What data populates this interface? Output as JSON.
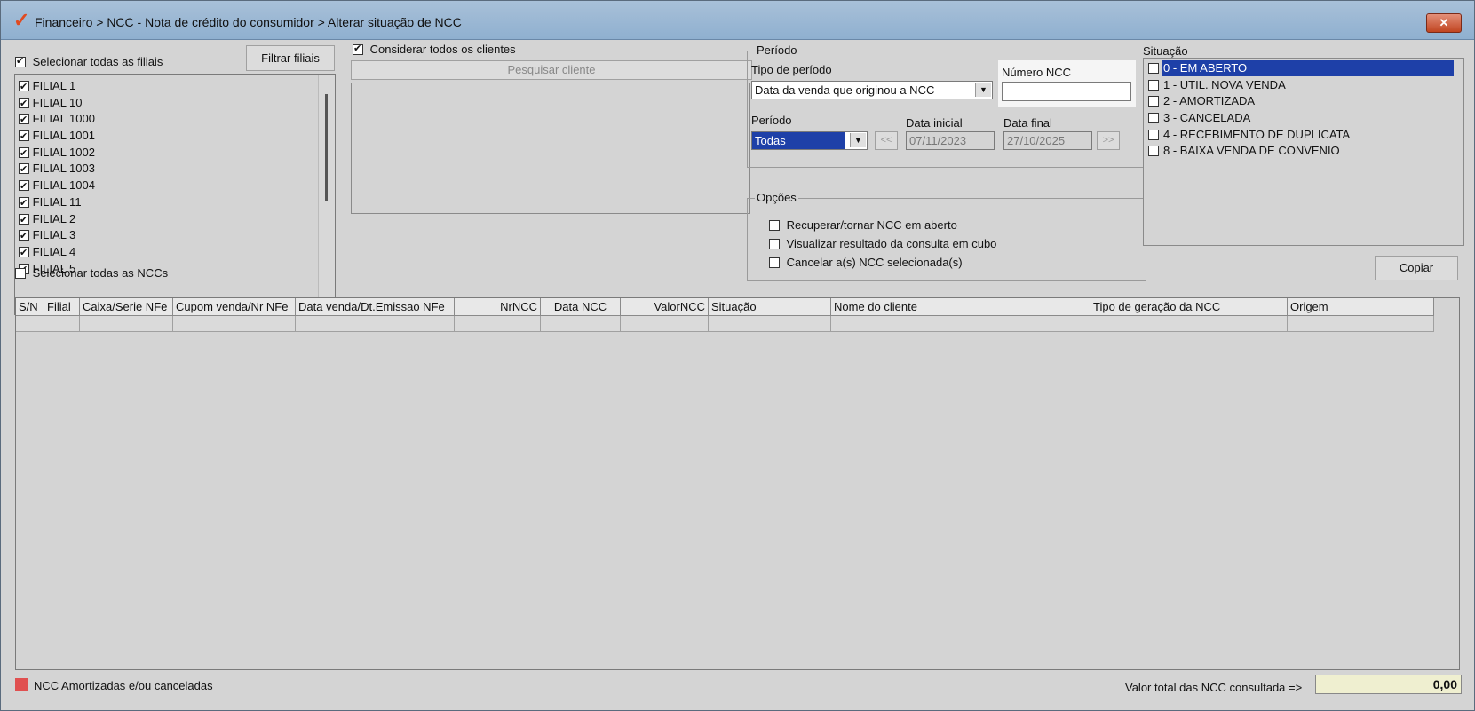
{
  "window": {
    "title": "Financeiro > NCC - Nota de crédito do consumidor > Alterar situação de NCC",
    "close": "✕"
  },
  "filiais": {
    "select_all_label": "Selecionar todas as filiais",
    "filter_button": "Filtrar filiais",
    "items": [
      "FILIAL 1",
      "FILIAL 10",
      "FILIAL 1000",
      "FILIAL 1001",
      "FILIAL 1002",
      "FILIAL 1003",
      "FILIAL 1004",
      "FILIAL 11",
      "FILIAL 2",
      "FILIAL 3",
      "FILIAL 4",
      "FILIAL 5"
    ]
  },
  "clientes": {
    "consider_all_label": "Considerar todos os clientes",
    "search_button": "Pesquisar cliente"
  },
  "periodo": {
    "legend": "Período",
    "tipo_label": "Tipo de período",
    "tipo_value": "Data da venda que originou a NCC",
    "numero_ncc_label": "Número NCC",
    "numero_ncc_value": "",
    "periodo_label": "Período",
    "periodo_value": "Todas",
    "prev_button": "<<",
    "next_button": ">>",
    "data_inicial_label": "Data inicial",
    "data_inicial_value": "07/11/2023",
    "data_final_label": "Data final",
    "data_final_value": "27/10/2025"
  },
  "opcoes": {
    "legend": "Opções",
    "items": [
      "Recuperar/tornar NCC em aberto",
      "Visualizar resultado da consulta em cubo",
      "Cancelar a(s) NCC selecionada(s)"
    ]
  },
  "situacao": {
    "label": "Situação",
    "items": [
      "0 - EM ABERTO",
      "1 - UTIL. NOVA VENDA",
      "2 - AMORTIZADA",
      "3 - CANCELADA",
      "4 - RECEBIMENTO DE DUPLICATA",
      "8 - BAIXA VENDA DE CONVENIO"
    ]
  },
  "copiar_button": "Copiar",
  "ncc": {
    "select_all_label": "Selecionar todas as NCCs",
    "columns": [
      "S/N",
      "Filial",
      "Caixa/Serie NFe",
      "Cupom venda/Nr NFe",
      "Data venda/Dt.Emissao NFe",
      "NrNCC",
      "Data NCC",
      "ValorNCC",
      "Situação",
      "Nome do cliente",
      "Tipo de geração da NCC",
      "Origem"
    ]
  },
  "footer": {
    "legend_label": "NCC Amortizadas e/ou canceladas",
    "legend_color": "#e05050",
    "total_label": "Valor total das NCC consultada =>",
    "total_value": "0,00"
  }
}
